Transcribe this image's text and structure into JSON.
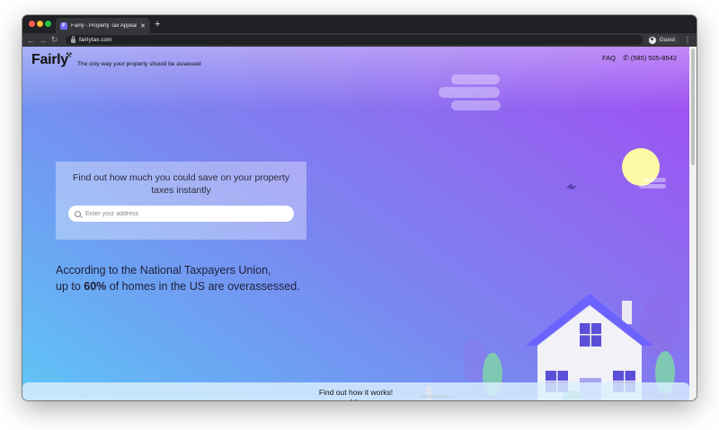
{
  "browser": {
    "tab_title": "Fairly - Property Tax Appeals",
    "tab_favicon_letter": "F",
    "url": "fairlytax.com",
    "profile_label": "Guest"
  },
  "header": {
    "logo": "Fairly",
    "tagline": "The only way your property should be assessed",
    "faq_label": "FAQ",
    "phone": "(585) 505-8542"
  },
  "hero": {
    "card_title": "Find out how much you could save on your property taxes instantly",
    "search_placeholder": "Enter your address",
    "stat_line1": "According to the National Taxpayers Union,",
    "stat_line2_prefix": "up to ",
    "stat_line2_strong": "60%",
    "stat_line2_suffix": " of homes in the US are overassessed."
  },
  "footer_bar": {
    "label": "Find out how it works!"
  },
  "colors": {
    "gradient_top": "#a24bf4",
    "gradient_bottom": "#5fc6f6",
    "house_roof": "#6c63ff",
    "sun": "#fdfaa6",
    "tree": "#7fc8b4"
  }
}
